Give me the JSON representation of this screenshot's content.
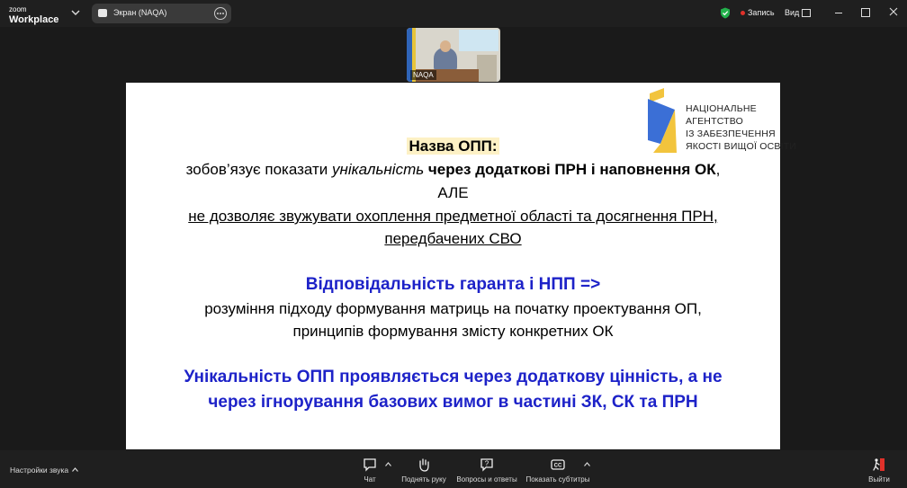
{
  "topbar": {
    "logo_line1": "zoom",
    "logo_line2": "Workplace",
    "screen_share_label": "Экран (NAQA)",
    "record_label": "Запись",
    "view_label": "Вид"
  },
  "video": {
    "participant_name": "NAQA"
  },
  "slide": {
    "agency_logo_lines": [
      "НАЦІОНАЛЬНЕ",
      "АГЕНТСТВО",
      "ІЗ ЗАБЕЗПЕЧЕННЯ",
      "ЯКОСТІ ВИЩОЇ ОСВІТИ"
    ],
    "title": "Назва ОПП:",
    "line2_a": "зобов’язує показати ",
    "line2_b": "унікальність",
    "line2_c": " через додаткові ПРН і наповнення ОК",
    "line2_d": ",",
    "line3": "АЛЕ",
    "line4": "не дозволяє звужувати охоплення предметної області та досягнення ПРН,",
    "line5": "передбачених СВО",
    "line6": "Відповідальність гаранта і НПП =>",
    "line7": "розуміння підходу формування матриць на початку проектування ОП,",
    "line8": "принципів формування змісту конкретних ОК",
    "line9": "Унікальність ОПП проявляється через додаткову цінність, а не",
    "line10": "через ігнорування базових вимог в частині ЗК, СК та ПРН",
    "colors": {
      "accent_blue": "#1d22c8",
      "highlight": "#fdf1c5",
      "logo_blue": "#3b6fd6",
      "logo_yellow": "#f2c43d"
    }
  },
  "bottombar": {
    "sound_settings_label": "Настройки звука",
    "chat_label": "Чат",
    "raise_hand_label": "Поднять руку",
    "qa_label": "Вопросы и ответы",
    "captions_label": "Показать субтитры",
    "leave_label": "Выйти"
  }
}
